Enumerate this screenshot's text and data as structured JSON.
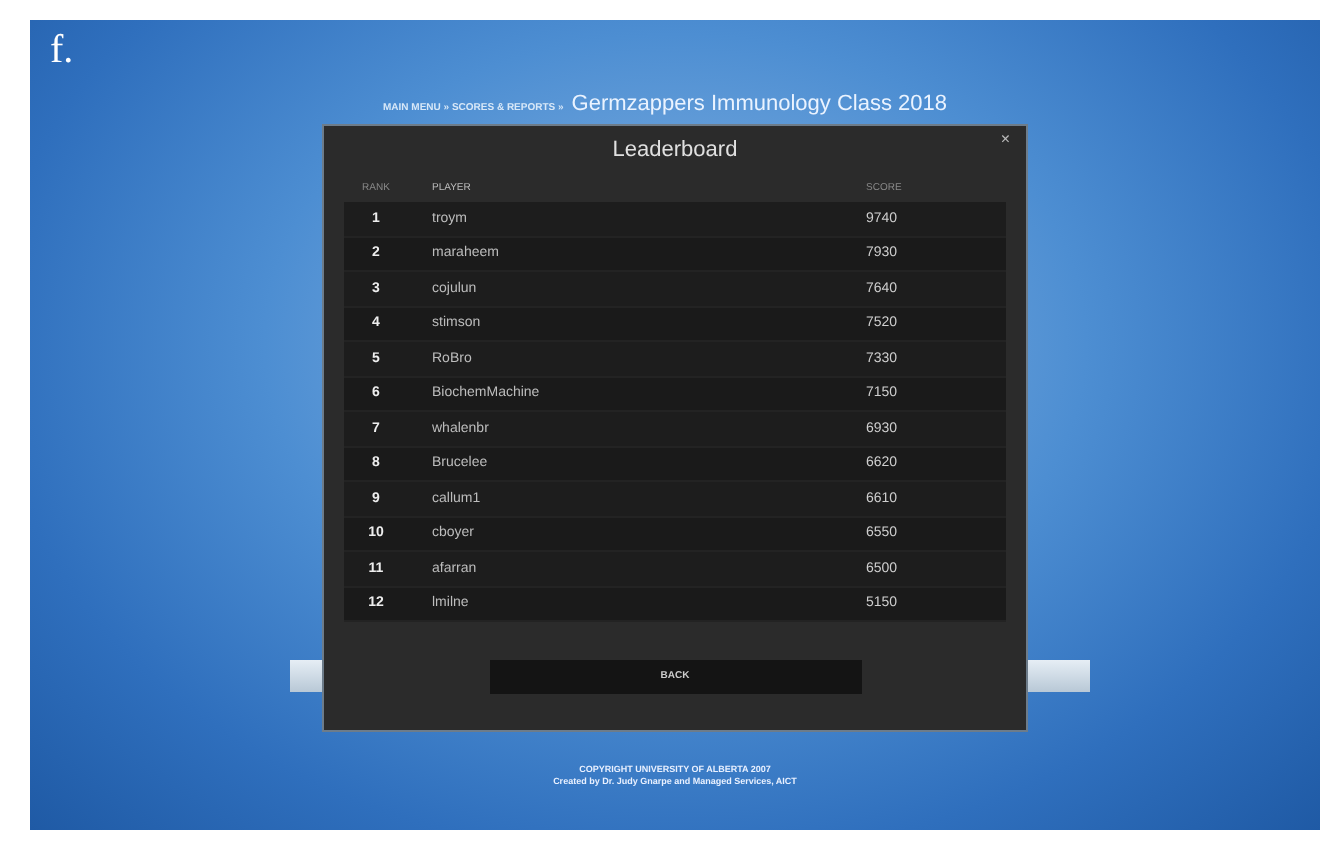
{
  "figure_label": "f.",
  "breadcrumb": {
    "path": "MAIN MENU » SCORES & REPORTS »",
    "title": "Germzappers Immunology Class 2018"
  },
  "dialog": {
    "title": "Leaderboard",
    "close": "×",
    "columns": [
      "RANK",
      "PLAYER",
      "SCORE"
    ],
    "rows": [
      {
        "rank": "1",
        "player": "troym",
        "score": "9740"
      },
      {
        "rank": "2",
        "player": "maraheem",
        "score": "7930"
      },
      {
        "rank": "3",
        "player": "cojulun",
        "score": "7640"
      },
      {
        "rank": "4",
        "player": "stimson",
        "score": "7520"
      },
      {
        "rank": "5",
        "player": "RoBro",
        "score": "7330"
      },
      {
        "rank": "6",
        "player": "BiochemMachine",
        "score": "7150"
      },
      {
        "rank": "7",
        "player": "whalenbr",
        "score": "6930"
      },
      {
        "rank": "8",
        "player": "Brucelee",
        "score": "6620"
      },
      {
        "rank": "9",
        "player": "callum1",
        "score": "6610"
      },
      {
        "rank": "10",
        "player": "cboyer",
        "score": "6550"
      },
      {
        "rank": "11",
        "player": "afarran",
        "score": "6500"
      },
      {
        "rank": "12",
        "player": "lmilne",
        "score": "5150"
      }
    ],
    "back_button": "BACK"
  },
  "footer": [
    "COPYRIGHT UNIVERSITY OF ALBERTA 2007",
    "Created by Dr. Judy Gnarpe and Managed Services, AICT"
  ]
}
